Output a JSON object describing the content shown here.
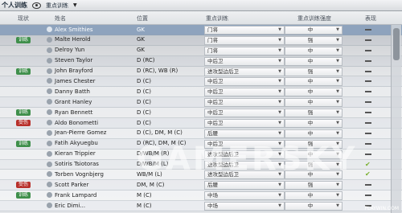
{
  "topbar": {
    "title": "个人训练",
    "dropdown": "重点训练"
  },
  "header": {
    "status": "现状",
    "name": "姓名",
    "position": "位置",
    "focus": "重点训练",
    "intensity": "重点训练强度",
    "performance": "表现"
  },
  "rows": [
    {
      "status": "",
      "status_color": "",
      "name": "Alex Smithies",
      "position": "GK",
      "training": "门将",
      "intensity": "中",
      "perf": "dash",
      "selected": true
    },
    {
      "status": "训练",
      "status_color": "green",
      "name": "Malte Herold",
      "position": "GK",
      "training": "门将",
      "intensity": "强",
      "perf": "dash"
    },
    {
      "status": "",
      "status_color": "",
      "name": "Delroy Yun",
      "position": "GK",
      "training": "门将",
      "intensity": "中",
      "perf": "dash"
    },
    {
      "status": "",
      "status_color": "",
      "name": "Steven Taylor",
      "position": "D (RC)",
      "training": "中后卫",
      "intensity": "中",
      "perf": "dash"
    },
    {
      "status": "训练",
      "status_color": "green",
      "name": "John Brayford",
      "position": "D (RC), WB (R)",
      "training": "进攻型边后卫",
      "intensity": "强",
      "perf": "dash"
    },
    {
      "status": "",
      "status_color": "",
      "name": "James Chester",
      "position": "D (C)",
      "training": "中后卫",
      "intensity": "中",
      "perf": "dash"
    },
    {
      "status": "",
      "status_color": "",
      "name": "Danny Batth",
      "position": "D (C)",
      "training": "中后卫",
      "intensity": "中",
      "perf": "dash"
    },
    {
      "status": "",
      "status_color": "",
      "name": "Grant Hanley",
      "position": "D (C)",
      "training": "中后卫",
      "intensity": "中",
      "perf": "dash"
    },
    {
      "status": "训练",
      "status_color": "green",
      "name": "Ryan Bennett",
      "position": "D (C)",
      "training": "中后卫",
      "intensity": "强",
      "perf": "dash"
    },
    {
      "status": "受伤",
      "status_color": "red",
      "name": "Aldo Bonometti",
      "position": "D (C)",
      "training": "中后卫",
      "intensity": "中",
      "perf": "dash"
    },
    {
      "status": "",
      "status_color": "",
      "name": "Jean-Pierre Gomez",
      "position": "D (C), DM, M (C)",
      "training": "后腰",
      "intensity": "中",
      "perf": "dash"
    },
    {
      "status": "训练",
      "status_color": "green",
      "name": "Fatih Akyuegbu",
      "position": "D (RC), DM, M (C)",
      "training": "中后卫",
      "intensity": "强",
      "perf": "dash"
    },
    {
      "status": "",
      "status_color": "",
      "name": "Kieran Trippier",
      "position": "D/WB/M (R)",
      "training": "进攻型边后卫",
      "intensity": "中",
      "perf": "dash"
    },
    {
      "status": "",
      "status_color": "",
      "name": "Sotiris Tsiotoras",
      "position": "D/WB/M (L)",
      "training": "进攻型边后卫",
      "intensity": "强",
      "perf": "check"
    },
    {
      "status": "",
      "status_color": "",
      "name": "Torben Vognbjerg",
      "position": "WB/M (L)",
      "training": "进攻型边后卫",
      "intensity": "中",
      "perf": "check"
    },
    {
      "status": "受伤",
      "status_color": "red",
      "name": "Scott Parker",
      "position": "DM, M (C)",
      "training": "后腰",
      "intensity": "强",
      "perf": "dash"
    },
    {
      "status": "训练",
      "status_color": "green",
      "name": "Frank Lampard",
      "position": "M (C)",
      "training": "中场",
      "intensity": "中",
      "perf": "dash"
    },
    {
      "status": "",
      "status_color": "",
      "name": "Eric Dimi...",
      "position": "M (C)",
      "training": "中场",
      "intensity": "中",
      "perf": "dash"
    }
  ],
  "watermark": "GAMERSKY",
  "corner_text": "PLAYWIN.COM"
}
